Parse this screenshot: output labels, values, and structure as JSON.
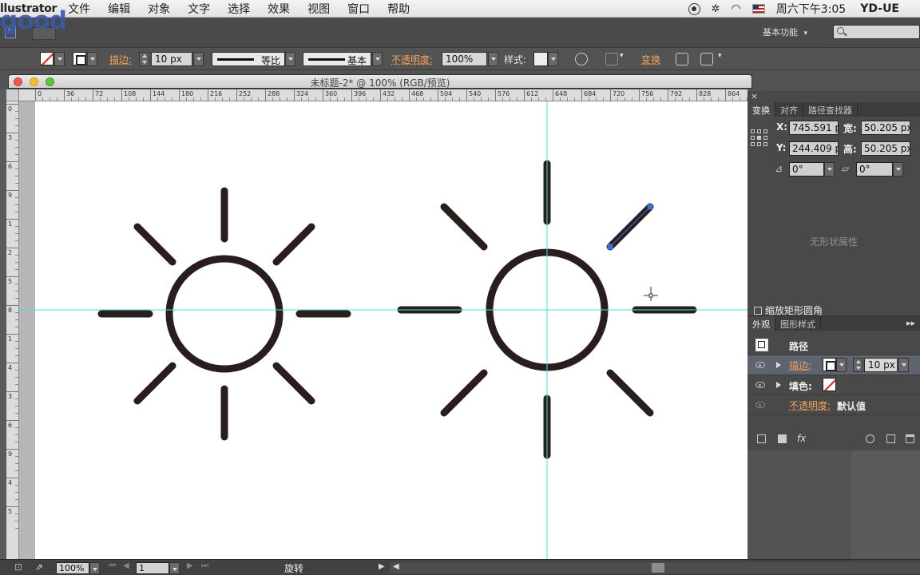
{
  "menubar": {
    "app": "llustrator",
    "items": [
      "文件",
      "编辑",
      "对象",
      "文字",
      "选择",
      "效果",
      "视图",
      "窗口",
      "帮助"
    ],
    "clock": "周六下午3:05",
    "user": "YD-UE"
  },
  "watermark": "good",
  "header": {
    "workspace": "基本功能",
    "workspace_caret": "▾"
  },
  "control": {
    "stroke_label": "描边:",
    "stroke_weight": "10 px",
    "profile_uniform": "等比",
    "profile_basic": "基本",
    "opacity_label": "不透明度:",
    "opacity_value": "100%",
    "style_label": "样式:",
    "transform_label": "变换"
  },
  "document": {
    "title": "未标题-2* @ 100% (RGB/预览)"
  },
  "ruler_h": [
    "0",
    "36",
    "72",
    "108",
    "144",
    "180",
    "216",
    "252",
    "288",
    "324",
    "360",
    "396",
    "432",
    "468",
    "504",
    "540",
    "576",
    "612",
    "648",
    "684",
    "720",
    "756",
    "792",
    "828",
    "864"
  ],
  "ruler_v": [
    "0",
    "3",
    "6",
    "9",
    "1",
    "2",
    "5",
    "8",
    "1",
    "4",
    "3",
    "6",
    "9",
    "4",
    "5"
  ],
  "transform_panel": {
    "close": "×",
    "tabs": [
      "变换",
      "对齐",
      "路径查找器"
    ],
    "x_label": "X:",
    "x_value": "745.591 px",
    "y_label": "Y:",
    "y_value": "244.409 px",
    "w_label": "宽:",
    "w_value": "50.205 px",
    "h_label": "高:",
    "h_value": "50.205 px",
    "rotate_value": "0°",
    "shear_value": "0°",
    "no_shape_props": "无形状属性",
    "scale_corners": "缩放矩形圆角"
  },
  "appearance_panel": {
    "tabs": [
      "外观",
      "图形样式"
    ],
    "menu": "▸▸",
    "object_label": "路径",
    "stroke_label": "描边:",
    "stroke_weight": "10 px",
    "fill_label": "填色:",
    "opacity_label": "不透明度:",
    "opacity_value": "默认值",
    "fx_label": "fx"
  },
  "statusbar": {
    "zoom": "100%",
    "artboard": "1",
    "tool": "旋转"
  },
  "colors": {
    "guide": "#40e0e8",
    "art": "#2a1d1d",
    "accent": "#f3a45a",
    "selection": "#3d6fd9"
  }
}
